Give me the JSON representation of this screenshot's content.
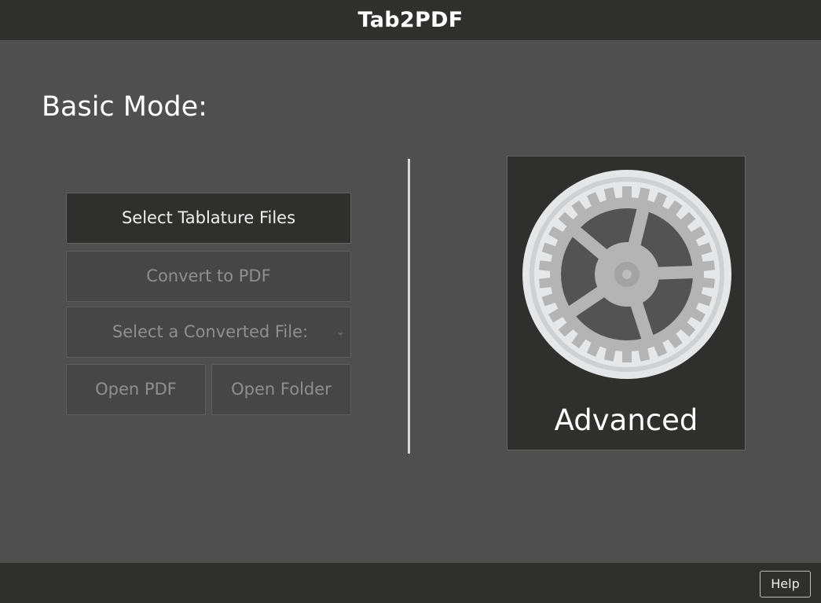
{
  "app": {
    "title": "Tab2PDF"
  },
  "basic_mode": {
    "heading": "Basic Mode:",
    "select_files_label": "Select Tablature Files",
    "convert_label": "Convert to PDF",
    "converted_file_select": {
      "selected_value": "Select a Converted File:"
    },
    "open_pdf_label": "Open PDF",
    "open_folder_label": "Open Folder"
  },
  "advanced": {
    "label": "Advanced",
    "icon": "gear-icon"
  },
  "footer": {
    "help_label": "Help"
  },
  "colors": {
    "background": "#4f4f4f",
    "bar": "#2f2f2e",
    "text": "#ffffff",
    "disabled_text": "#8f8f8f"
  }
}
